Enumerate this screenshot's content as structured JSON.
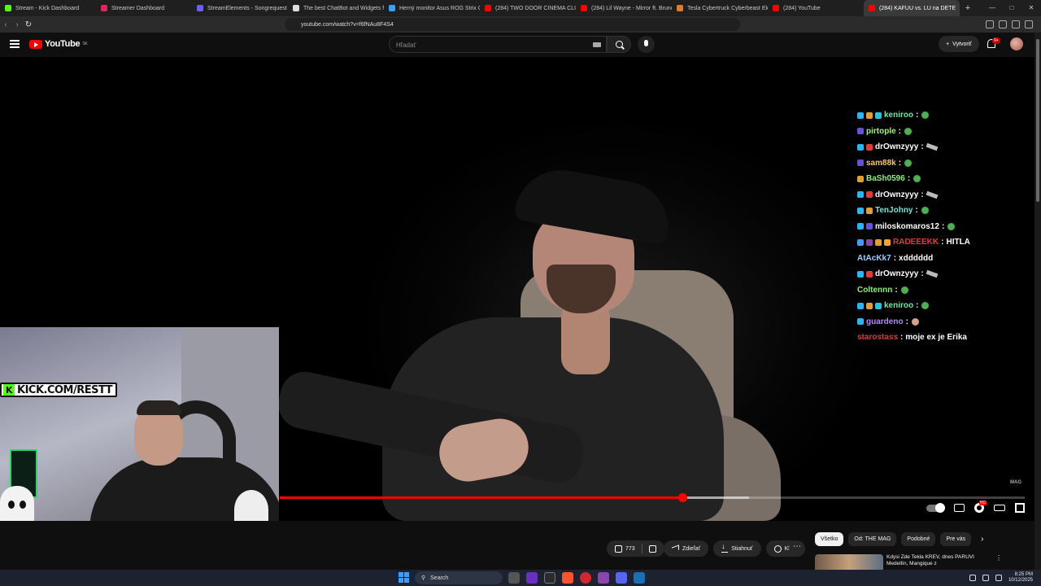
{
  "browser": {
    "tabs": [
      {
        "title": "Stream - Kick Dashboard",
        "color": "#53fc18"
      },
      {
        "title": "Streamer Dashboard",
        "color": "#e0245e"
      },
      {
        "title": "StreamElements - Songrequest",
        "color": "#6d5dfc"
      },
      {
        "title": "The best ChatBot and Widgets for",
        "color": "#dddddd"
      },
      {
        "title": "Herný monitor Asus ROG Strix OLI",
        "color": "#3aa0ff"
      },
      {
        "title": "(284) TWO DOOR CINEMA CLUB |",
        "color": "#ff0000"
      },
      {
        "title": "(284) Lil Wayne - Mirror ft. Bruno",
        "color": "#ff0000"
      },
      {
        "title": "Tesla Cybertruck Cyberbeast Electr",
        "color": "#e07a2c"
      },
      {
        "title": "(284) YouTube",
        "color": "#ff0000"
      },
      {
        "title": "(284) KAFUU vs. LU na DETE",
        "color": "#ff0000",
        "active": true
      }
    ],
    "url": "youtube.com/watch?v=f6fNAu8F4S4"
  },
  "youtube": {
    "logo_text": "YouTube",
    "region": "SK",
    "search_placeholder": "Hľadať",
    "create_label": "Vytvoriť",
    "notif_count": "9+"
  },
  "chat": [
    {
      "user": "keniroo",
      "color": "#6ee7a8",
      "msg": "",
      "badges": [
        "#29b6f6",
        "#e0a030",
        "#26c6da"
      ],
      "emote": "green"
    },
    {
      "user": "pirtople",
      "color": "#a8f07a",
      "msg": "",
      "badges": [
        "#6a4fd8"
      ],
      "emote": "green"
    },
    {
      "user": "drOwnzyyy",
      "color": "#ffffff",
      "msg": "",
      "badges": [
        "#29b6f6",
        "#e53935"
      ],
      "emote": "knife"
    },
    {
      "user": "sam88k",
      "color": "#f5c96b",
      "msg": "",
      "badges": [
        "#6a4fd8"
      ],
      "emote": "green"
    },
    {
      "user": "BaSh0596",
      "color": "#8ef07a",
      "msg": "",
      "badges": [
        "#e0a030"
      ],
      "emote": "green"
    },
    {
      "user": "drOwnzyyy",
      "color": "#ffffff",
      "msg": "",
      "badges": [
        "#29b6f6",
        "#e53935"
      ],
      "emote": "knife"
    },
    {
      "user": "TenJohny",
      "color": "#6ee7d8",
      "msg": "",
      "badges": [
        "#29b6f6",
        "#e0a030"
      ],
      "emote": "green"
    },
    {
      "user": "miloskomaros12",
      "color": "#ffffff",
      "msg": "",
      "badges": [
        "#29b6f6",
        "#6a4fd8"
      ],
      "emote": "green"
    },
    {
      "user": "RADEEEKK",
      "color": "#e53935",
      "msg": "HITLA",
      "badges": [
        "#3aa0ff",
        "#8e44ad",
        "#e0a030",
        "#f5a623"
      ],
      "emote": ""
    },
    {
      "user": "AtAcKk7",
      "color": "#9ecbff",
      "msg": "xdddddd",
      "badges": [],
      "emote": ""
    },
    {
      "user": "drOwnzyyy",
      "color": "#ffffff",
      "msg": "",
      "badges": [
        "#29b6f6",
        "#e53935"
      ],
      "emote": "knife"
    },
    {
      "user": "Coltennn",
      "color": "#8ef07a",
      "msg": "",
      "badges": [],
      "emote": "green"
    },
    {
      "user": "keniroo",
      "color": "#6ee7a8",
      "msg": "",
      "badges": [
        "#29b6f6",
        "#e0a030",
        "#26c6da"
      ],
      "emote": "green"
    },
    {
      "user": "guardeno",
      "color": "#b388ff",
      "msg": "",
      "badges": [
        "#29b6f6"
      ],
      "emote": "face"
    },
    {
      "user": "starostass",
      "color": "#e53935",
      "msg": "moje ex je Erika",
      "badges": [],
      "emote": ""
    }
  ],
  "overlay": {
    "kick_banner": "KICK.COM/RESTT",
    "video_watermark": "MAG"
  },
  "player": {
    "played_fraction": 0.54,
    "buffered_fraction": 0.63
  },
  "actions": {
    "like_count": "773",
    "share_label": "Zdieľať",
    "download_label": "Stiahnuť",
    "clip_label": "Klip"
  },
  "chips": [
    "Všetko",
    "Od: THE MAG",
    "Podobné",
    "Pre vás"
  ],
  "recommendation": {
    "title": "Kdysi Zde Tekla KREV, dnes PARUVI Medellín, Mangique z"
  },
  "taskbar": {
    "search_label": "Search",
    "time": "8:25 PM",
    "date": "10/12/2025"
  }
}
